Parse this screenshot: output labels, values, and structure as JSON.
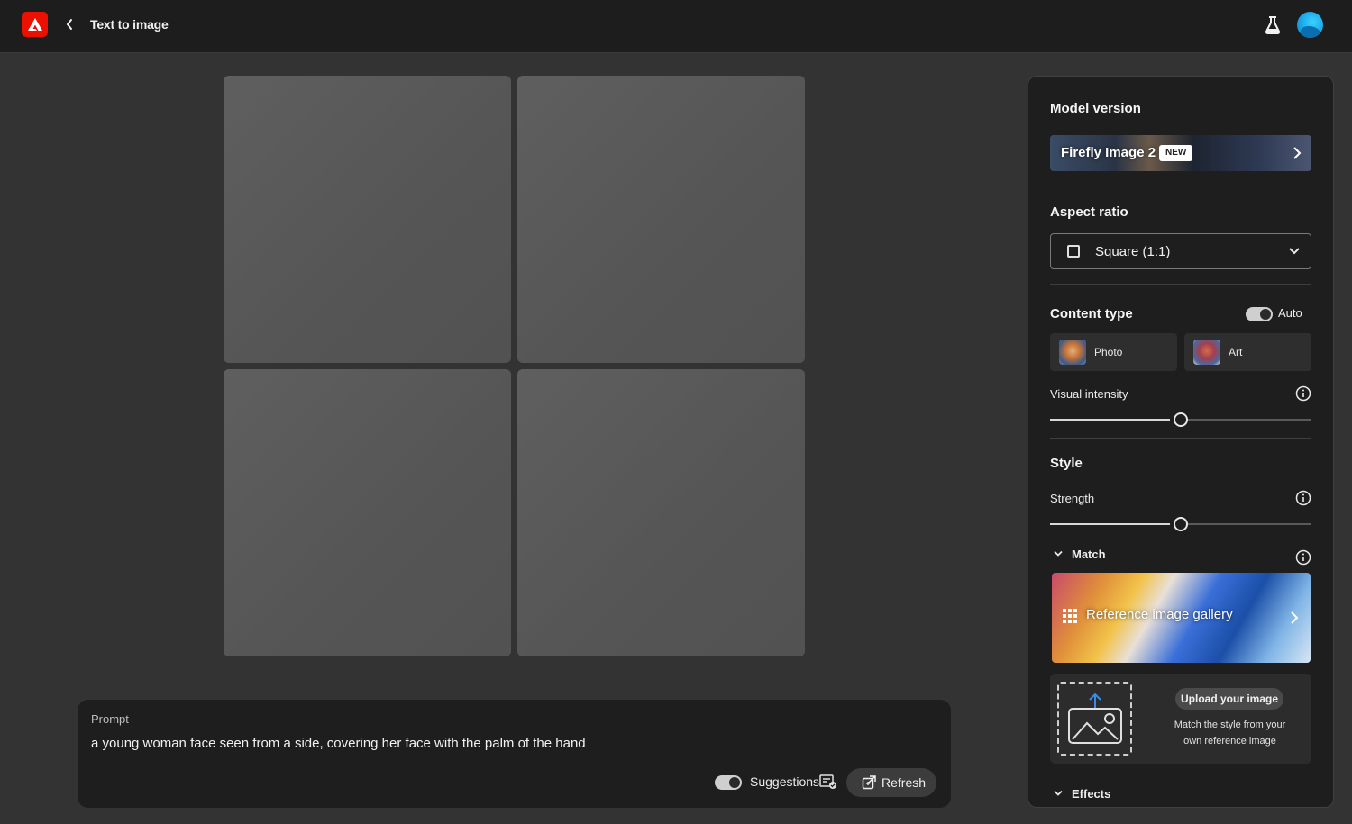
{
  "header": {
    "app_icon": "adobe-logo-icon",
    "back_icon": "chevron-left-icon",
    "title": "Text to image",
    "labs_icon": "flask-icon",
    "avatar_icon": "avatar"
  },
  "prompt": {
    "label": "Prompt",
    "text": "a young woman face seen from a side, covering her face with the palm of the hand",
    "suggestions_label": "Suggestions",
    "suggestions_on": true,
    "refresh_label": "Refresh"
  },
  "panel": {
    "model_version": {
      "heading": "Model version",
      "value": "Firefly Image 2",
      "badge": "NEW"
    },
    "aspect_ratio": {
      "heading": "Aspect ratio",
      "value": "Square (1:1)"
    },
    "content_type": {
      "heading": "Content type",
      "auto_label": "Auto",
      "auto_on": true,
      "options": [
        {
          "label": "Photo"
        },
        {
          "label": "Art"
        }
      ]
    },
    "visual_intensity": {
      "label": "Visual intensity",
      "value_fraction": 0.5
    },
    "style": {
      "heading": "Style",
      "strength_label": "Strength",
      "strength_fraction": 0.5,
      "match_label": "Match",
      "gallery_label": "Reference image gallery",
      "upload_button": "Upload your image",
      "upload_desc": "Match the style from your own reference image"
    },
    "effects": {
      "heading": "Effects"
    }
  },
  "colors": {
    "accent_brand": "#eb1000",
    "background": "#333333",
    "panel": "#1e1e1e"
  }
}
